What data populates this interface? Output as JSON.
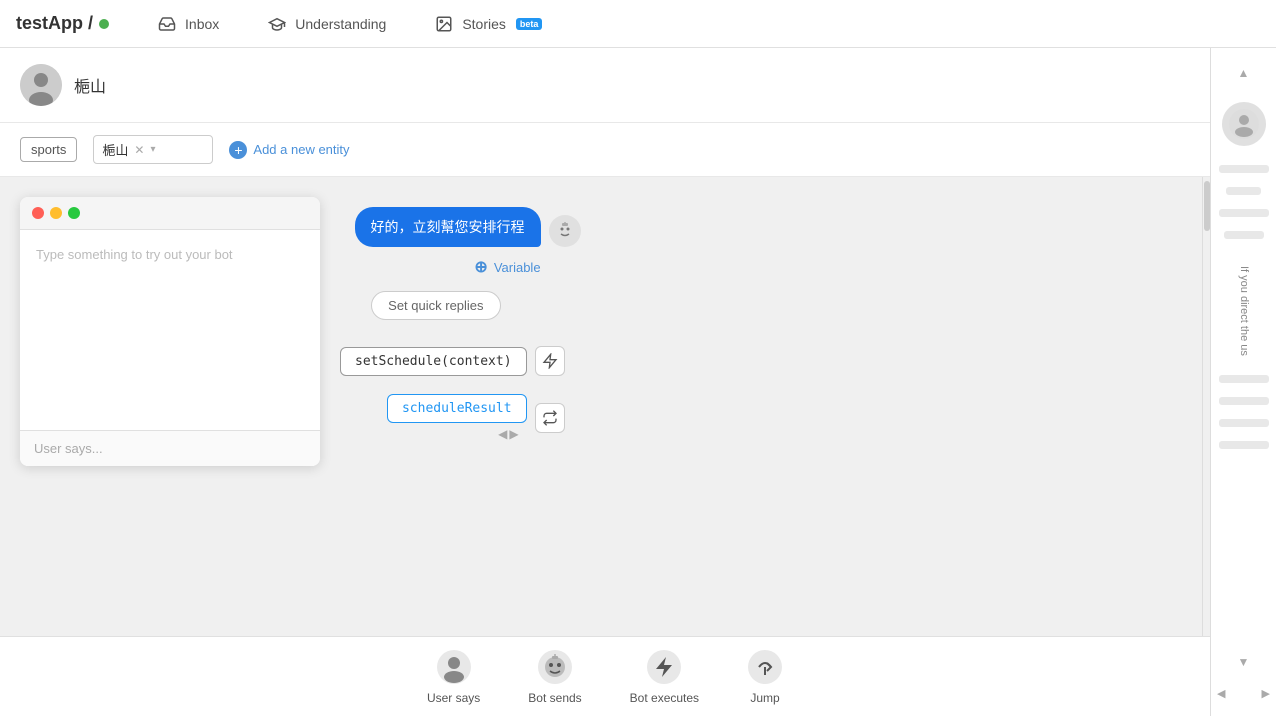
{
  "nav": {
    "logo": "testApp /",
    "logo_dot_color": "#4CAF50",
    "items": [
      {
        "id": "inbox",
        "label": "Inbox",
        "icon": "inbox-icon"
      },
      {
        "id": "understanding",
        "label": "Understanding",
        "icon": "graduation-icon"
      },
      {
        "id": "stories",
        "label": "Stories",
        "icon": "image-icon",
        "badge": "beta"
      }
    ]
  },
  "user": {
    "name": "梔山",
    "avatar_icon": "user-avatar-icon"
  },
  "entity": {
    "tag_label": "sports",
    "select_value": "梔山",
    "add_label": "Add a new entity"
  },
  "chat_window": {
    "placeholder": "Type something to try out your bot",
    "input_placeholder": "User says..."
  },
  "bot_response": {
    "message": "好的，立刻幫您安排行程",
    "variable_label": "Variable",
    "quick_replies_label": "Set quick replies"
  },
  "code_block": {
    "set_schedule": "setSchedule(context)",
    "schedule_result": "scheduleResult"
  },
  "toolbar": {
    "items": [
      {
        "id": "user-says",
        "label": "User says",
        "icon": "user-circle-icon"
      },
      {
        "id": "bot-sends",
        "label": "Bot sends",
        "icon": "bot-face-icon"
      },
      {
        "id": "bot-executes",
        "label": "Bot executes",
        "icon": "lightning-icon"
      },
      {
        "id": "jump",
        "label": "Jump",
        "icon": "jump-icon"
      }
    ]
  },
  "side_panel": {
    "text": "If you direct the us"
  },
  "scroll": {
    "up_arrow": "▲",
    "down_arrow": "▼",
    "left_arrow": "◀",
    "right_arrow": "▶"
  }
}
